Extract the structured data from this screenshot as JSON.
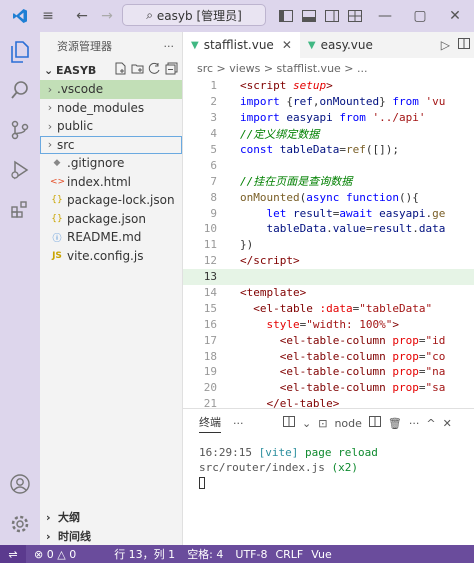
{
  "titlebar": {
    "search_text": "easyb [管理员]",
    "search_icon": "search-icon",
    "back_icon": "arrow-left-icon",
    "forward_icon": "arrow-right-icon"
  },
  "sidebar": {
    "header": "资源管理器",
    "header_more": "···",
    "folder": "EASYB",
    "items": [
      {
        "label": ".vscode",
        "type": "folder"
      },
      {
        "label": "node_modules",
        "type": "folder"
      },
      {
        "label": "public",
        "type": "folder"
      },
      {
        "label": "src",
        "type": "folder"
      },
      {
        "label": ".gitignore",
        "type": "git"
      },
      {
        "label": "index.html",
        "type": "html"
      },
      {
        "label": "package-lock.json",
        "type": "json"
      },
      {
        "label": "package.json",
        "type": "json"
      },
      {
        "label": "README.md",
        "type": "info"
      },
      {
        "label": "vite.config.js",
        "type": "js"
      }
    ],
    "outline": "大纲",
    "timeline": "时间线"
  },
  "editor": {
    "tabs": [
      {
        "label": "stafflist.vue",
        "active": true
      },
      {
        "label": "easy.vue",
        "active": false
      }
    ],
    "breadcrumb": "src > views > stafflist.vue > ...",
    "current_line": 13,
    "lines": [
      {
        "n": "1",
        "html": "<span class='tg'>&lt;script</span> <span class='at' style='font-style:italic'>setup</span><span class='tg'>&gt;</span>"
      },
      {
        "n": "2",
        "html": "<span class='kw'>import</span> {<span class='vr'>ref</span>,<span class='vr'>onMounted</span>} <span class='kw'>from</span> <span class='str'>'vu</span>"
      },
      {
        "n": "3",
        "html": "<span class='kw'>import</span> <span class='vr'>easyapi</span> <span class='kw'>from</span> <span class='str'>'../api'</span>"
      },
      {
        "n": "4",
        "html": "<span class='cm'>//定义绑定数据</span>"
      },
      {
        "n": "5",
        "html": "<span class='kw'>const</span> <span class='vr'>tableData</span>=<span class='fn'>ref</span>([]);"
      },
      {
        "n": "6",
        "html": ""
      },
      {
        "n": "7",
        "html": "<span class='cm'>//挂在页面是查询数据</span>"
      },
      {
        "n": "8",
        "html": "<span class='fn'>onMounted</span>(<span class='kw'>async</span> <span class='kw'>function</span>(){"
      },
      {
        "n": "9",
        "html": "    <span class='kw'>let</span> <span class='vr'>result</span>=<span class='kw'>await</span> <span class='vr'>easyapi</span>.<span class='fn'>ge</span>"
      },
      {
        "n": "10",
        "html": "    <span class='vr'>tableData</span>.<span class='vr'>value</span>=<span class='vr'>result</span>.<span class='vr'>data</span>"
      },
      {
        "n": "11",
        "html": "})"
      },
      {
        "n": "12",
        "html": "<span class='tg'>&lt;/script&gt;</span>"
      },
      {
        "n": "13",
        "html": ""
      },
      {
        "n": "14",
        "html": "<span class='tg'>&lt;template&gt;</span>"
      },
      {
        "n": "15",
        "html": "  <span class='tg'>&lt;el-table</span> <span class='at'>:data</span>=<span class='str'>\"tableData\"</span>"
      },
      {
        "n": "16",
        "html": "    <span class='at'>style</span>=<span class='str'>\"width: 100%\"</span><span class='tg'>&gt;</span>"
      },
      {
        "n": "17",
        "html": "      <span class='tg'>&lt;el-table-column</span> <span class='at'>prop</span>=<span class='str'>\"id</span>"
      },
      {
        "n": "18",
        "html": "      <span class='tg'>&lt;el-table-column</span> <span class='at'>prop</span>=<span class='str'>\"co</span>"
      },
      {
        "n": "19",
        "html": "      <span class='tg'>&lt;el-table-column</span> <span class='at'>prop</span>=<span class='str'>\"na</span>"
      },
      {
        "n": "20",
        "html": "      <span class='tg'>&lt;el-table-column</span> <span class='at'>prop</span>=<span class='str'>\"sa</span>"
      },
      {
        "n": "21",
        "html": "    <span class='tg'>&lt;/el-table&gt;</span>"
      }
    ]
  },
  "panel": {
    "title": "终端",
    "more": "···",
    "terminal_name": "node",
    "output_time": "16:29:15",
    "output_tag": "[vite]",
    "output_msg": "page reload",
    "output_path": "src/router/index.js",
    "output_count": "(x2)"
  },
  "status": {
    "errors": "0",
    "warnings": "0",
    "position": "行 13，列 1",
    "spaces": "空格: 4",
    "encoding": "UTF-8",
    "eol": "CRLF",
    "lang": "Vue"
  }
}
